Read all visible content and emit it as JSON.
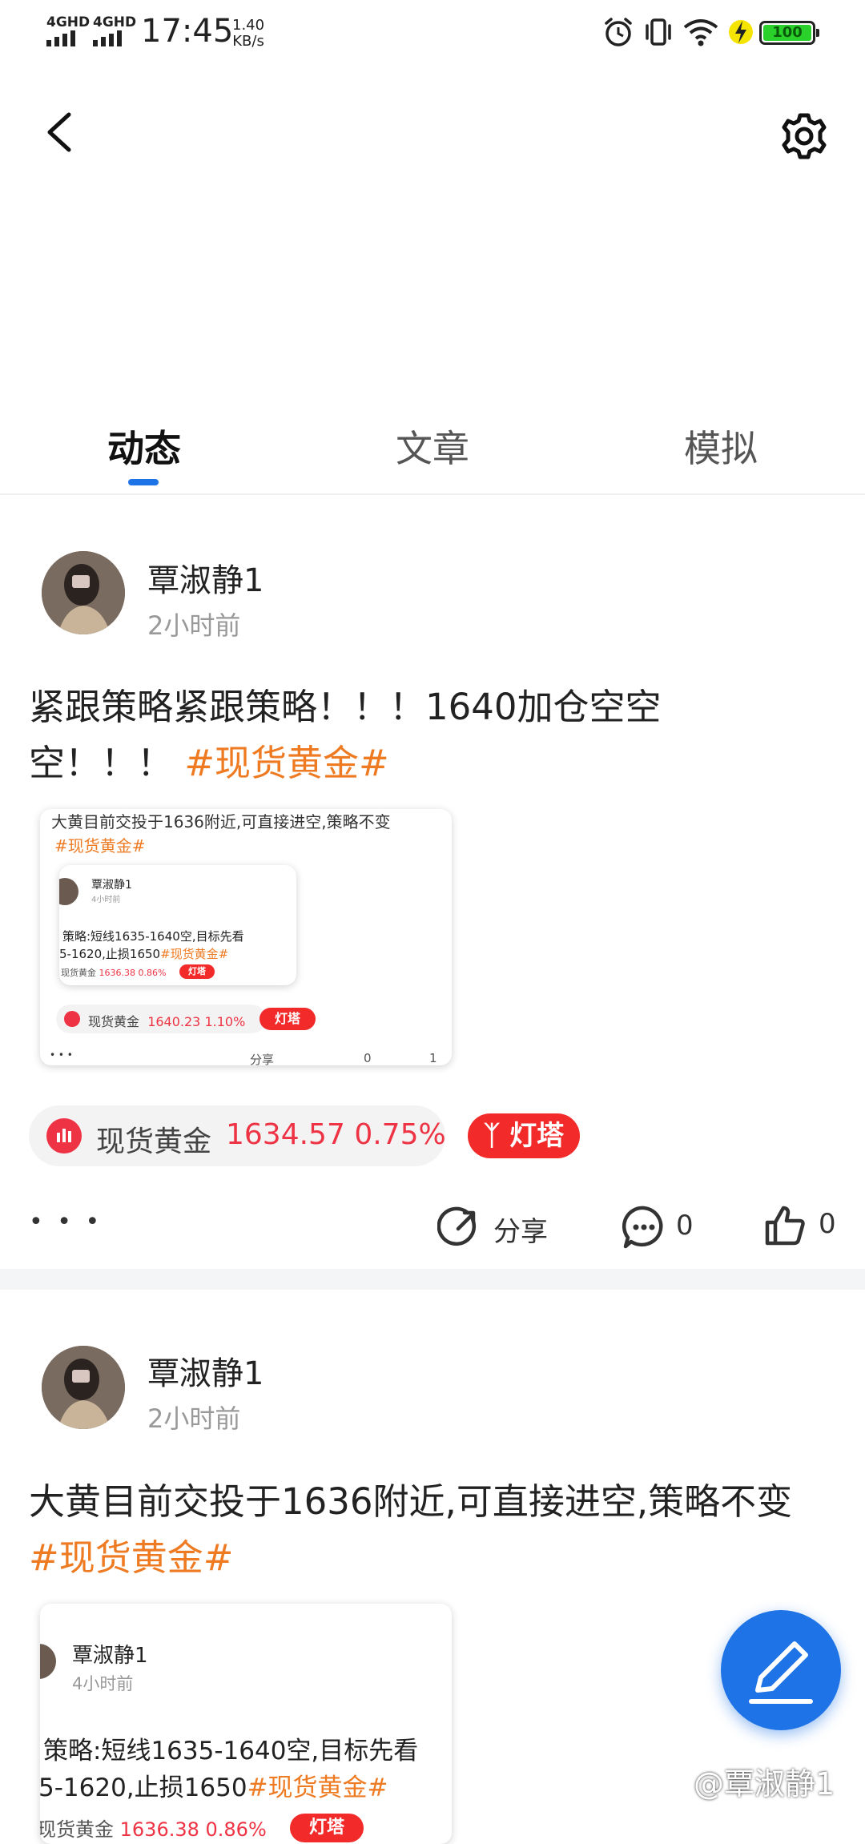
{
  "status_bar": {
    "signal_1": "4GHD",
    "signal_2": "4GHD",
    "time": "17:45",
    "rate_value": "1.40",
    "rate_unit": "KB/s",
    "battery": "100"
  },
  "tabs": [
    {
      "label": "动态"
    },
    {
      "label": "文章"
    },
    {
      "label": "模拟"
    }
  ],
  "posts": [
    {
      "author": "覃淑静1",
      "time": "2小时前",
      "text_line1": "紧跟策略紧跟策略！！！1640加仓空空",
      "text_line2": "空！！！",
      "hashtag": "#现货黄金#",
      "embed": {
        "text": "大黄目前交投于1636附近,可直接进空,策略不变",
        "hashtag": "#现货黄金#",
        "inner_author": "覃淑静1",
        "inner_time": "4小时前",
        "inner_text_1": "策略:短线1635-1640空,目标先看",
        "inner_text_2": "5-1620,止损1650",
        "inner_hashtag": "#现货黄金#",
        "inner_quote_name": "现货黄金",
        "inner_quote_value": "1636.38 0.86%",
        "inner_beacon": "灯塔",
        "quote_name": "现货黄金",
        "quote_value": "1640.23 1.10%",
        "beacon": "灯塔",
        "more": "• • •",
        "share": "分享",
        "comments": "0",
        "likes": "1"
      },
      "quote": {
        "name": "现货黄金",
        "value": "1634.57 0.75%"
      },
      "beacon": "灯塔",
      "more": "• • •",
      "share": "分享",
      "comments": "0",
      "likes": "0"
    },
    {
      "author": "覃淑静1",
      "time": "2小时前",
      "text_line1": "大黄目前交投于1636附近,可直接进空,策略不变",
      "hashtag": "#现货黄金#",
      "embed": {
        "inner_author": "覃淑静1",
        "inner_time": "4小时前",
        "inner_text_1": "策略:短线1635-1640空,目标先看",
        "inner_text_2": "5-1620,止损1650",
        "inner_hashtag": "#现货黄金#",
        "inner_quote_name": "现货黄金",
        "inner_quote_value": "1636.38 0.86%",
        "inner_beacon": "灯塔"
      }
    }
  ],
  "watermark": "@覃淑静1",
  "colors": {
    "accent": "#1e74e6",
    "hashtag": "#ee7a22",
    "quote": "#ee3344"
  }
}
